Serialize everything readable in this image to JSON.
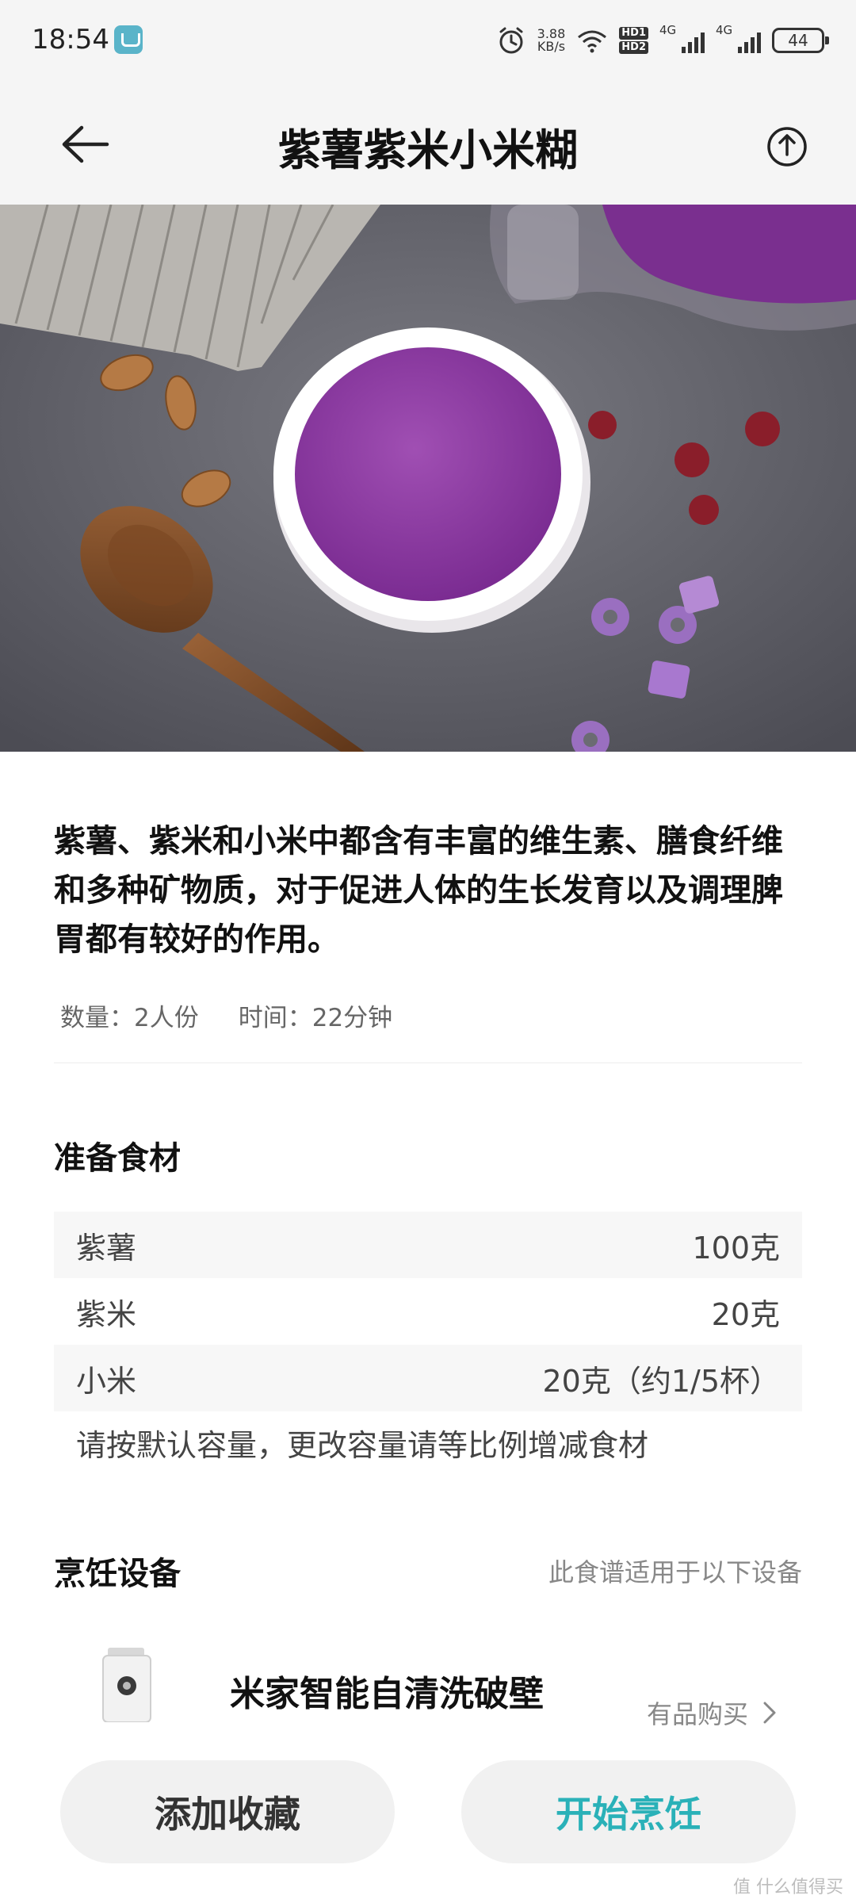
{
  "status_bar": {
    "time": "18:54",
    "net_speed_value": "3.88",
    "net_speed_unit": "KB/s",
    "hd1": "HD1",
    "hd2": "HD2",
    "signal1_label": "4G",
    "signal2_label": "4G",
    "battery": "44"
  },
  "header": {
    "title": "紫薯紫米小米糊"
  },
  "recipe": {
    "description": "紫薯、紫米和小米中都含有丰富的维生素、膳食纤维和多种矿物质，对于促进人体的生长发育以及调理脾胃都有较好的作用。",
    "servings": "数量：2人份",
    "time": "时间：22分钟"
  },
  "ingredients": {
    "title": "准备食材",
    "items": [
      {
        "name": "紫薯",
        "amount": "100克"
      },
      {
        "name": "紫米",
        "amount": "20克"
      },
      {
        "name": "小米",
        "amount": "20克（约1/5杯）"
      }
    ],
    "note": "请按默认容量，更改容量请等比例增减食材"
  },
  "devices": {
    "title": "烹饪设备",
    "subtitle": "此食谱适用于以下设备",
    "device_name": "米家智能自清洗破壁",
    "buy_label": "有品购买"
  },
  "actions": {
    "favorite": "添加收藏",
    "start": "开始烹饪"
  },
  "watermark": "值 什么值得买",
  "colors": {
    "accent": "#2ab1b8",
    "header_bg": "#f5f5f5",
    "button_bg": "#f1f1f1"
  },
  "icons": [
    "back-arrow-icon",
    "share-icon",
    "chevron-right-icon",
    "alarm-icon",
    "wifi-icon",
    "battery-icon"
  ]
}
